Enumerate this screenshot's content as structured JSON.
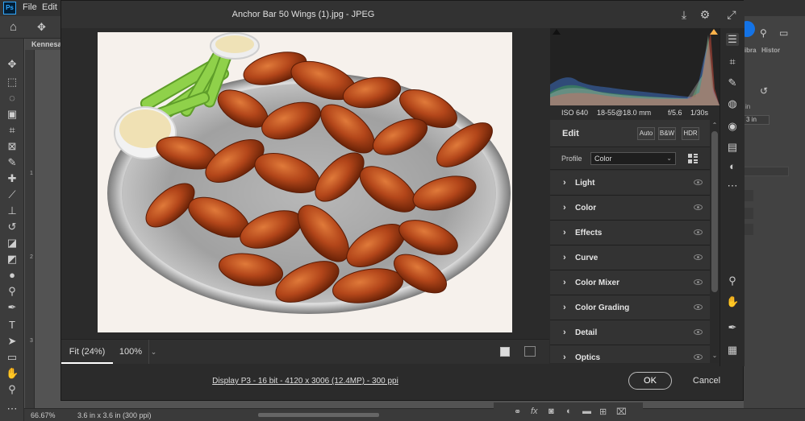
{
  "photoshop": {
    "menus": [
      "File",
      "Edit"
    ],
    "doc_tab": "Kennesa",
    "zoom_status": "66.67%",
    "doc_size_status": "3.6 in x 3.6 in (300 ppi)",
    "right_tabs": [
      "Libra",
      "Histor"
    ],
    "right_values": [
      "in",
      "3 in"
    ],
    "ruler_marks": [
      "1",
      "2",
      "3"
    ]
  },
  "dialog": {
    "title": "Anchor Bar 50 Wings (1).jpg  -  JPEG",
    "camera_info": {
      "iso": "ISO 640",
      "lens": "18-55@18.0 mm",
      "aperture": "f/5.6",
      "shutter": "1/30s"
    },
    "edit": {
      "title": "Edit",
      "auto_label": "Auto",
      "bw_label": "B&W",
      "hdr_label": "HDR",
      "profile_label": "Profile",
      "profile_value": "Color",
      "sections": [
        {
          "label": "Light"
        },
        {
          "label": "Color"
        },
        {
          "label": "Effects"
        },
        {
          "label": "Curve"
        },
        {
          "label": "Color Mixer"
        },
        {
          "label": "Color Grading"
        },
        {
          "label": "Detail"
        },
        {
          "label": "Optics"
        }
      ]
    },
    "zoom": {
      "fit_label": "Fit (24%)",
      "zoom_value": "100%"
    },
    "footer_link": "Display P3 - 16 bit - 4120 x 3006 (12.4MP) - 300 ppi",
    "ok_label": "OK",
    "cancel_label": "Cancel"
  },
  "colors": {
    "accent": "#1473e6",
    "dialog_bg": "#2b2b2b",
    "panel_bg": "#333333"
  }
}
